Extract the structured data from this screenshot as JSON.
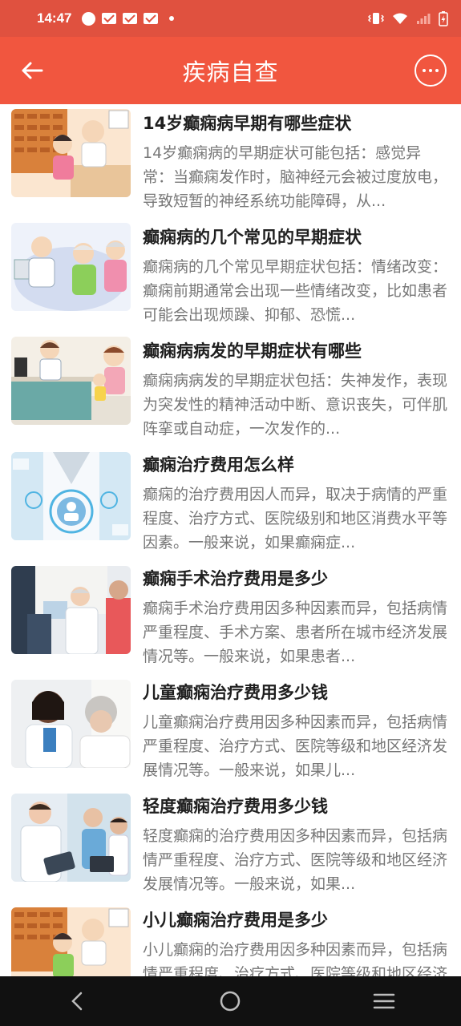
{
  "status_bar": {
    "time": "14:47"
  },
  "app_bar": {
    "title": "疾病自查"
  },
  "items": [
    {
      "title": "14岁癫痫病早期有哪些症状",
      "desc": "14岁癫痫病的早期症状可能包括：感觉异常：当癫痫发作时，脑神经元会被过度放电，导致短暂的神经系统功能障碍，从..."
    },
    {
      "title": "癫痫病的几个常见的早期症状",
      "desc": "癫痫病的几个常见早期症状包括：情绪改变：癫痫前期通常会出现一些情绪改变，比如患者可能会出现烦躁、抑郁、恐慌..."
    },
    {
      "title": "癫痫病病发的早期症状有哪些",
      "desc": "癫痫病病发的早期症状包括：失神发作，表现为突发性的精神活动中断、意识丧失，可伴肌阵挛或自动症，一次发作的..."
    },
    {
      "title": "癫痫治疗费用怎么样",
      "desc": "癫痫的治疗费用因人而异，取决于病情的严重程度、治疗方式、医院级别和地区消费水平等因素。一般来说，如果癫痫症..."
    },
    {
      "title": "癫痫手术治疗费用是多少",
      "desc": "癫痫手术治疗费用因多种因素而异，包括病情严重程度、手术方案、患者所在城市经济发展情况等。一般来说，如果患者..."
    },
    {
      "title": "儿童癫痫治疗费用多少钱",
      "desc": "儿童癫痫治疗费用因多种因素而异，包括病情严重程度、治疗方式、医院等级和地区经济发展情况等。一般来说，如果儿..."
    },
    {
      "title": "轻度癫痫治疗费用多少钱",
      "desc": "轻度癫痫的治疗费用因多种因素而异，包括病情严重程度、治疗方式、医院等级和地区经济发展情况等。一般来说，如果..."
    },
    {
      "title": "小儿癫痫治疗费用是多少",
      "desc": "小儿癫痫的治疗费用因多种因素而异，包括病情严重程度、治疗方式、医院等级和地区经济发展情况等。"
    }
  ]
}
